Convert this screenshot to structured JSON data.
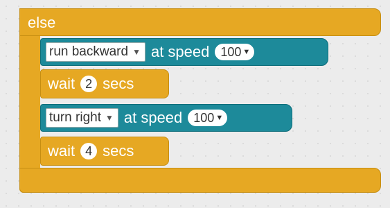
{
  "colors": {
    "control_block": "#e6a823",
    "motor_block": "#1d8a9a",
    "canvas": "#ececec"
  },
  "else_block": {
    "label": "else"
  },
  "blocks": [
    {
      "dropdown": "run backward",
      "text": "at speed",
      "speed": "100"
    },
    {
      "label_wait": "wait",
      "value": "2",
      "unit": "secs"
    },
    {
      "dropdown": "turn right",
      "text": "at speed",
      "speed": "100"
    },
    {
      "label_wait": "wait",
      "value": "4",
      "unit": "secs"
    }
  ]
}
